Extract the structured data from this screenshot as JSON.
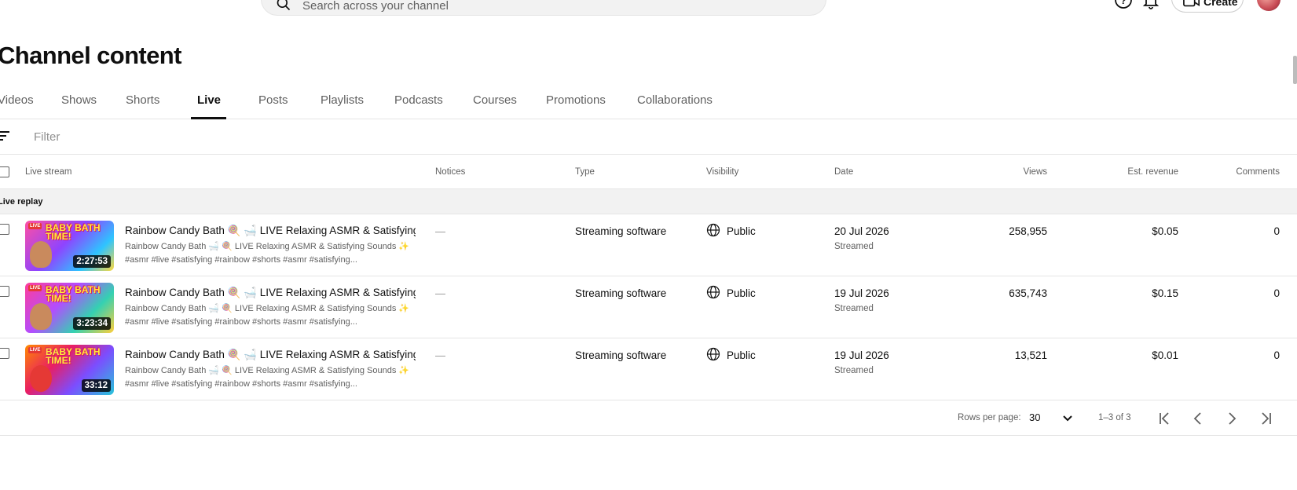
{
  "header": {
    "search_placeholder": "Search across your channel",
    "create_label": "Create",
    "icons": [
      "search-icon",
      "help-icon",
      "bell-icon",
      "create-video-icon",
      "avatar"
    ]
  },
  "page_title": "Channel content",
  "tabs": [
    {
      "label": "Videos",
      "active": false
    },
    {
      "label": "Shows",
      "active": false
    },
    {
      "label": "Shorts",
      "active": false
    },
    {
      "label": "Live",
      "active": true
    },
    {
      "label": "Posts",
      "active": false
    },
    {
      "label": "Playlists",
      "active": false
    },
    {
      "label": "Podcasts",
      "active": false
    },
    {
      "label": "Courses",
      "active": false
    },
    {
      "label": "Promotions",
      "active": false
    },
    {
      "label": "Collaborations",
      "active": false
    }
  ],
  "filter": {
    "label": "Filter"
  },
  "table": {
    "columns": {
      "live_stream": "Live stream",
      "notices": "Notices",
      "type": "Type",
      "visibility": "Visibility",
      "date": "Date",
      "views": "Views",
      "revenue": "Est. revenue",
      "comments": "Comments"
    },
    "group_label": "Live replay",
    "rows": [
      {
        "title": "Rainbow Candy Bath 🍭 🛁 LIVE Relaxing ASMR & Satisfying ...",
        "desc_line1": "Rainbow Candy Bath 🛁 🍭 LIVE Relaxing ASMR & Satisfying Sounds ✨",
        "desc_line2": "#asmr #live #satisfying #rainbow #shorts #asmr #satisfying...",
        "duration": "2:27:53",
        "notices": "—",
        "type": "Streaming software",
        "visibility": "Public",
        "date": "20 Jul 2026",
        "date_sub": "Streamed",
        "views": "258,955",
        "revenue": "$0.05",
        "comments": "0",
        "thumb_text": "BABY BATH TIME!"
      },
      {
        "title": "Rainbow Candy Bath 🍭 🛁 LIVE Relaxing ASMR & Satisfying ...",
        "desc_line1": "Rainbow Candy Bath 🛁 🍭 LIVE Relaxing ASMR & Satisfying Sounds ✨",
        "desc_line2": "#asmr #live #satisfying #rainbow #shorts #asmr #satisfying...",
        "duration": "3:23:34",
        "notices": "—",
        "type": "Streaming software",
        "visibility": "Public",
        "date": "19 Jul 2026",
        "date_sub": "Streamed",
        "views": "635,743",
        "revenue": "$0.15",
        "comments": "0",
        "thumb_text": "BABY BATH TIME!"
      },
      {
        "title": "Rainbow Candy Bath 🍭 🛁 LIVE Relaxing ASMR & Satisfying ...",
        "desc_line1": "Rainbow Candy Bath 🛁 🍭 LIVE Relaxing ASMR & Satisfying Sounds ✨",
        "desc_line2": "#asmr #live #satisfying #rainbow #shorts #asmr #satisfying...",
        "duration": "33:12",
        "notices": "—",
        "type": "Streaming software",
        "visibility": "Public",
        "date": "19 Jul 2026",
        "date_sub": "Streamed",
        "views": "13,521",
        "revenue": "$0.01",
        "comments": "0",
        "thumb_text": "BABY BATH TIME!"
      }
    ]
  },
  "pagination": {
    "rows_per_page_label": "Rows per page:",
    "rows_per_page_value": "30",
    "range": "1–3 of 3"
  },
  "colors": {
    "accent": "#0f0f0f",
    "muted": "#606060",
    "divider": "#e5e5e5",
    "group_bg": "#f2f2f2"
  }
}
